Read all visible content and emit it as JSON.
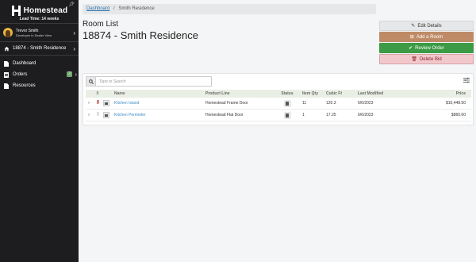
{
  "app": {
    "brand": "Homestead",
    "lead_time": "Lead Time: 14 weeks"
  },
  "user": {
    "name": "Trevor Smith",
    "role": "Developer in Dealer View"
  },
  "project": {
    "label": "18874 - Smith Residence"
  },
  "nav": {
    "dashboard": "Dashboard",
    "orders": "Orders",
    "orders_badge": "2",
    "resources": "Resources"
  },
  "breadcrumb": {
    "root": "Dashboard",
    "sep": "/",
    "current": "Smith Residence"
  },
  "page": {
    "section": "Room List",
    "title": "18874 - Smith Residence"
  },
  "actions": {
    "edit": "Edit Details",
    "add": "Add a Room",
    "review": "Review Order",
    "delete": "Delete Bid"
  },
  "colors": {
    "sidebar": "#1d1d1f",
    "add": "#bf8b67",
    "review": "#3d9a45",
    "delete_bg": "#f1c9cc",
    "link": "#3f8cc7"
  },
  "search": {
    "placeholder": "Type to Search"
  },
  "table": {
    "headers": {
      "name": "Name",
      "product_line": "Product Line",
      "status": "Status",
      "qty": "Item Qty",
      "cubic": "Cubic Ft",
      "modified": "Last Modified",
      "price": "Price"
    },
    "rows": [
      {
        "name": "Kitchen Island",
        "product_line": "Homestead Frame Door",
        "qty": "11",
        "cubic": "120.3",
        "modified": "6/6/2023",
        "price": "$10,448.50",
        "has_attachment": true
      },
      {
        "name": "Kitchen Perimeter",
        "product_line": "Homestead Flat Door",
        "qty": "1",
        "cubic": "17.25",
        "modified": "6/6/2023",
        "price": "$860.60",
        "has_attachment": false
      }
    ]
  }
}
